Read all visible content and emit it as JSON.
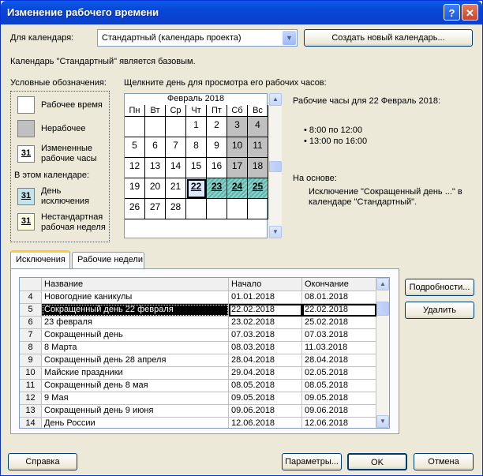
{
  "window": {
    "title": "Изменение рабочего времени"
  },
  "calendar_select": {
    "label": "Для календаря:",
    "value": "Стандартный (календарь проекта)"
  },
  "create_button": "Создать новый календарь...",
  "base_note": "Календарь \"Стандартный\" является базовым.",
  "legend": {
    "title": "Условные обозначения:",
    "working": "Рабочее время",
    "nonworking": "Нерабочее",
    "changed": "Измененные рабочие часы",
    "changed_line1": "Измененные",
    "changed_line2": "рабочие часы",
    "section": "В этом календаре:",
    "exception_line1": "День",
    "exception_line2": "исключения",
    "nonstd_line1": "Нестандартная",
    "nonstd_line2": "рабочая неделя",
    "sample_day": "31"
  },
  "calendar": {
    "instruction": "Щелкните день для просмотра его рабочих часов:",
    "month_title": "Февраль 2018",
    "weekdays": [
      "Пн",
      "Вт",
      "Ср",
      "Чт",
      "Пт",
      "Сб",
      "Вс"
    ],
    "weeks": [
      [
        "",
        "",
        "",
        "1",
        "2",
        "3",
        "4"
      ],
      [
        "5",
        "6",
        "7",
        "8",
        "9",
        "10",
        "11"
      ],
      [
        "12",
        "13",
        "14",
        "15",
        "16",
        "17",
        "18"
      ],
      [
        "19",
        "20",
        "21",
        "22",
        "23",
        "24",
        "25"
      ],
      [
        "26",
        "27",
        "28",
        "",
        "",
        "",
        ""
      ]
    ]
  },
  "info": {
    "hours_title": "Рабочие часы для 22 Февраль 2018:",
    "hours": [
      "8:00 по 12:00",
      "13:00 по 16:00"
    ],
    "based_on_label": "На основе:",
    "based_on_line1": "Исключение \"Сокращенный день ...\" в",
    "based_on_line2": "календаре \"Стандартный\"."
  },
  "tabs": [
    "Исключения",
    "Рабочие недели"
  ],
  "table": {
    "columns": [
      "Название",
      "Начало",
      "Окончание"
    ],
    "rows": [
      {
        "n": "4",
        "name": "Новогодние каникулы",
        "start": "01.01.2018",
        "end": "08.01.2018"
      },
      {
        "n": "5",
        "name": "Сокращенный день 22 февраля",
        "start": "22.02.2018",
        "end": "22.02.2018"
      },
      {
        "n": "6",
        "name": "23 февраля",
        "start": "23.02.2018",
        "end": "25.02.2018"
      },
      {
        "n": "7",
        "name": "Сокращенный день",
        "start": "07.03.2018",
        "end": "07.03.2018"
      },
      {
        "n": "8",
        "name": "8 Марта",
        "start": "08.03.2018",
        "end": "11.03.2018"
      },
      {
        "n": "9",
        "name": "Сокращенный день 28 апреля",
        "start": "28.04.2018",
        "end": "28.04.2018"
      },
      {
        "n": "10",
        "name": "Майские праздники",
        "start": "29.04.2018",
        "end": "02.05.2018"
      },
      {
        "n": "11",
        "name": "Сокращенный день 8 мая",
        "start": "08.05.2018",
        "end": "08.05.2018"
      },
      {
        "n": "12",
        "name": "9 Мая",
        "start": "09.05.2018",
        "end": "09.05.2018"
      },
      {
        "n": "13",
        "name": "Сокращенный день 9 июня",
        "start": "09.06.2018",
        "end": "09.06.2018"
      },
      {
        "n": "14",
        "name": "День России",
        "start": "12.06.2018",
        "end": "12.06.2018"
      }
    ]
  },
  "side_buttons": {
    "details": "Подробности...",
    "delete": "Удалить"
  },
  "footer": {
    "help": "Справка",
    "options": "Параметры...",
    "ok": "OK",
    "cancel": "Отмена"
  }
}
